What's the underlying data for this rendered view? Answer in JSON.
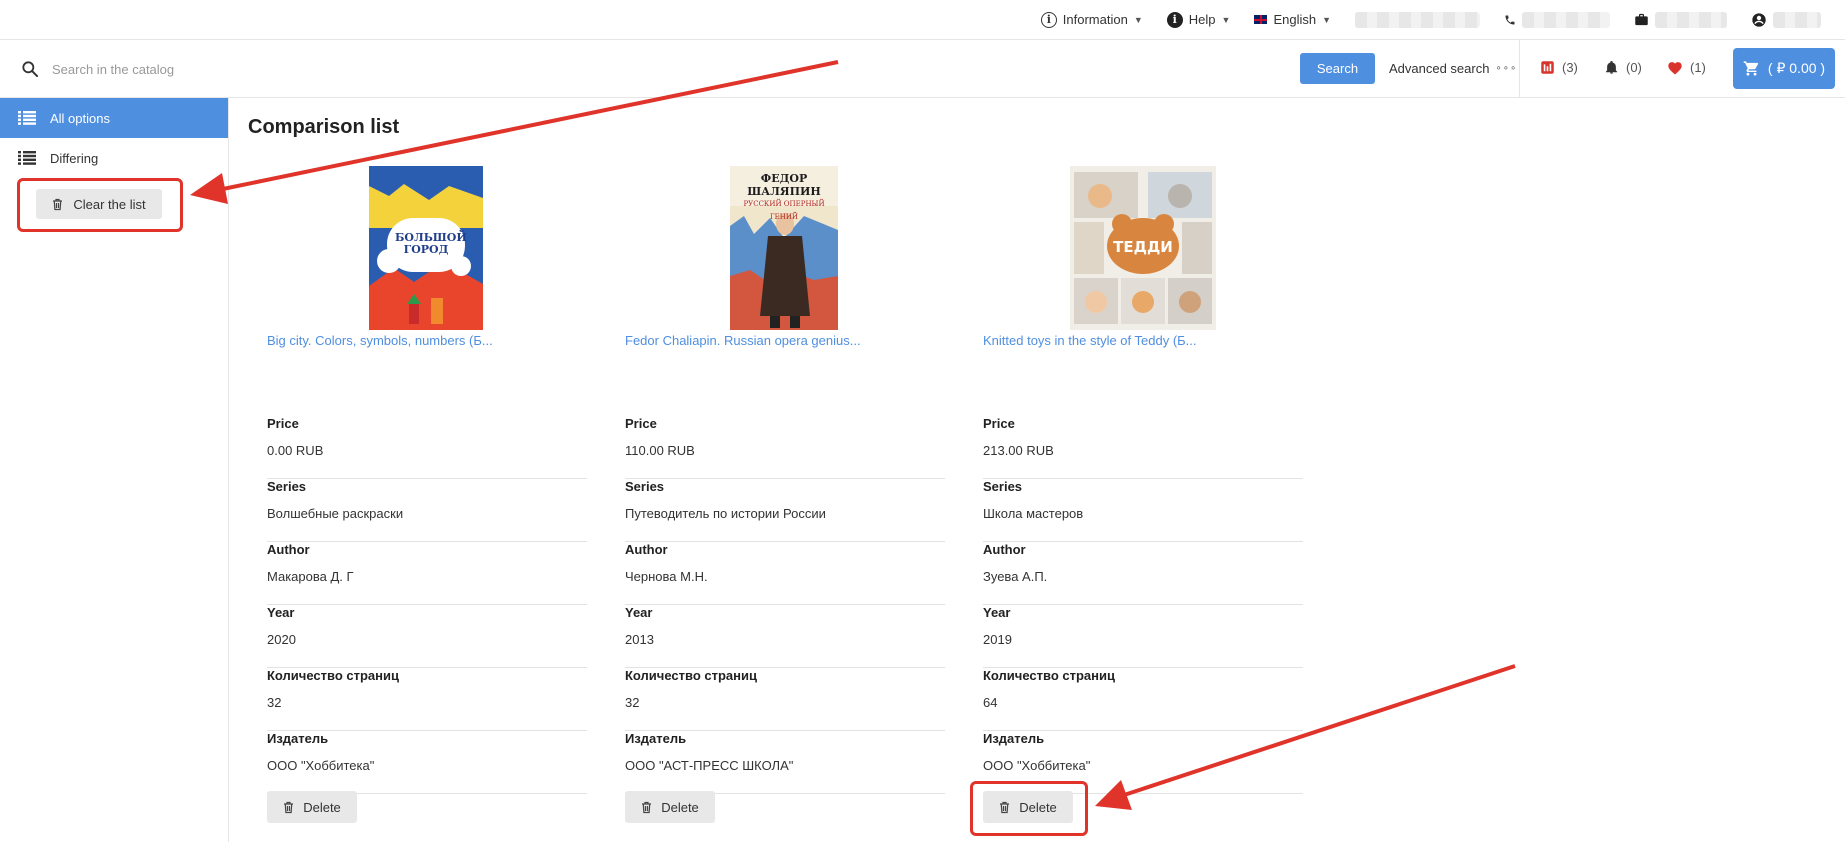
{
  "topbar": {
    "information": "Information",
    "help": "Help",
    "language": "English"
  },
  "search": {
    "placeholder": "Search in the catalog",
    "button": "Search",
    "advanced": "Advanced search"
  },
  "header_counters": {
    "compare": "(3)",
    "notifications": "(0)",
    "favorites": "(1)",
    "cart": "( ₽ 0.00 )"
  },
  "sidebar": {
    "items": [
      {
        "label": "All options"
      },
      {
        "label": "Differing"
      }
    ],
    "clear_label": "Clear the list"
  },
  "page_title": "Comparison list",
  "colors": {
    "accent": "#4f8fe0",
    "annotation": "#e0342b"
  },
  "products": [
    {
      "title": "Big city. Colors, symbols, numbers (Б...",
      "cover_text": [
        "БОЛЬШОЙ",
        "ГОРОД"
      ],
      "specs": [
        {
          "label": "Price",
          "value": "0.00 RUB"
        },
        {
          "label": "Series",
          "value": "Волшебные раскраски"
        },
        {
          "label": "Author",
          "value": "Макарова Д. Г"
        },
        {
          "label": "Year",
          "value": "2020"
        },
        {
          "label": "Количество страниц",
          "value": "32"
        },
        {
          "label": "Издатель",
          "value": "ООО \"Хоббитека\""
        }
      ],
      "delete_label": "Delete"
    },
    {
      "title": "Fedor Chaliapin. Russian opera genius...",
      "cover_text": [
        "ФЕДОР ШАЛЯПИН",
        "РУССКИЙ ОПЕРНЫЙ ГЕНИЙ"
      ],
      "specs": [
        {
          "label": "Price",
          "value": "110.00 RUB"
        },
        {
          "label": "Series",
          "value": "Путеводитель по истории России"
        },
        {
          "label": "Author",
          "value": "Чернова М.Н."
        },
        {
          "label": "Year",
          "value": "2013"
        },
        {
          "label": "Количество страниц",
          "value": "32"
        },
        {
          "label": "Издатель",
          "value": "ООО \"АСТ-ПРЕСС ШКОЛА\""
        }
      ],
      "delete_label": "Delete"
    },
    {
      "title": "Knitted toys in the style of Teddy (Б...",
      "cover_text": [
        "ТЕДДИ"
      ],
      "specs": [
        {
          "label": "Price",
          "value": "213.00 RUB"
        },
        {
          "label": "Series",
          "value": "Школа мастеров"
        },
        {
          "label": "Author",
          "value": "Зуева А.П."
        },
        {
          "label": "Year",
          "value": "2019"
        },
        {
          "label": "Количество страниц",
          "value": "64"
        },
        {
          "label": "Издатель",
          "value": "ООО \"Хоббитека\""
        }
      ],
      "delete_label": "Delete"
    }
  ]
}
